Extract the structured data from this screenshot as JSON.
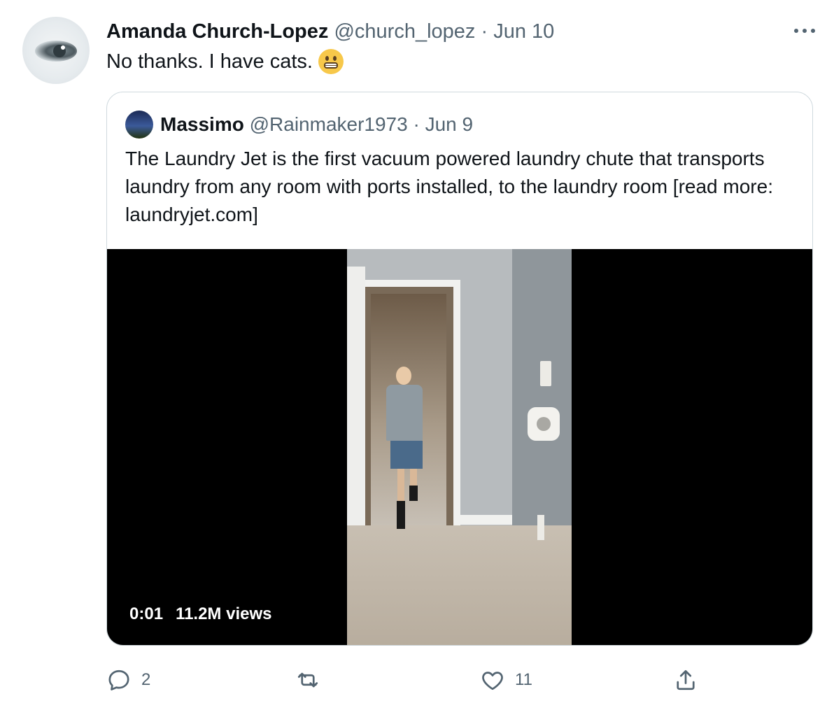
{
  "tweet": {
    "author_name": "Amanda Church-Lopez",
    "author_handle": "@church_lopez",
    "separator": "·",
    "date": "Jun 10",
    "text": "No thanks. I have cats.",
    "emoji_icon": "grimacing-face-icon",
    "more_icon": "more-horizontal-icon"
  },
  "quoted": {
    "author_name": "Massimo",
    "author_handle": "@Rainmaker1973",
    "separator": "·",
    "date": "Jun 9",
    "text": "The Laundry Jet is the first vacuum powered laundry chute that transports laundry from any room with ports installed, to the laundry room [read more: laundryjet.com]",
    "video": {
      "time": "0:01",
      "views": "11.2M views"
    }
  },
  "actions": {
    "reply": {
      "icon": "reply-icon",
      "count": "2"
    },
    "retweet": {
      "icon": "retweet-icon",
      "count": ""
    },
    "like": {
      "icon": "heart-icon",
      "count": "11"
    },
    "share": {
      "icon": "share-icon",
      "count": ""
    }
  },
  "colors": {
    "text": "#0f1419",
    "secondary": "#536471",
    "border": "#cfd9de",
    "video_bg": "#000000"
  }
}
